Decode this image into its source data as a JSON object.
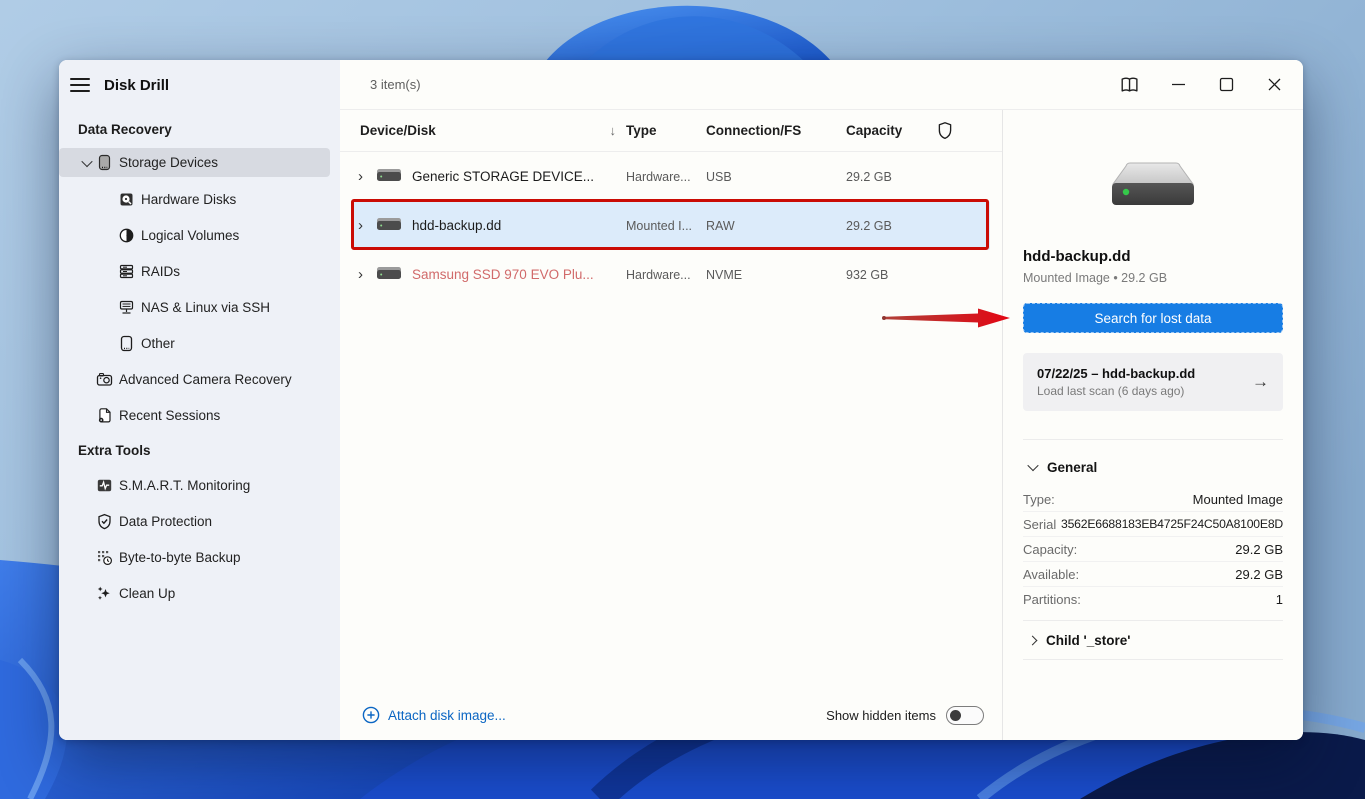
{
  "window": {
    "title": "Disk Drill",
    "item_count": "3 item(s)"
  },
  "icons": {
    "titlebar": [
      "menu-hamburger",
      "knowledge-base-book",
      "minimize",
      "maximize",
      "close"
    ],
    "table_header_shield": "protection-shield",
    "attach_plus": "circled-plus",
    "scan_arrow": "→",
    "sort_arrow": "↓"
  },
  "sidebar": {
    "sections": [
      {
        "header": "Data Recovery",
        "items": [
          {
            "label": "Storage Devices",
            "icon": "storage-devices",
            "selected": true,
            "expanded": true
          },
          {
            "label": "Hardware Disks",
            "icon": "hardware-disk"
          },
          {
            "label": "Logical Volumes",
            "icon": "logical-volume"
          },
          {
            "label": "RAIDs",
            "icon": "raid-stack"
          },
          {
            "label": "NAS & Linux via SSH",
            "icon": "nas-server"
          },
          {
            "label": "Other",
            "icon": "other-device"
          },
          {
            "label": "Advanced Camera Recovery",
            "icon": "camera"
          },
          {
            "label": "Recent Sessions",
            "icon": "session-file-gear"
          }
        ]
      },
      {
        "header": "Extra Tools",
        "items": [
          {
            "label": "S.M.A.R.T. Monitoring",
            "icon": "smart-monitor"
          },
          {
            "label": "Data Protection",
            "icon": "shield-check"
          },
          {
            "label": "Byte-to-byte Backup",
            "icon": "byte-grid-clock"
          },
          {
            "label": "Clean Up",
            "icon": "sparkles"
          }
        ]
      }
    ]
  },
  "table": {
    "columns": [
      "Device/Disk",
      "Type",
      "Connection/FS",
      "Capacity"
    ],
    "rows": [
      {
        "name": "Generic STORAGE DEVICE...",
        "type": "Hardware...",
        "fs": "USB",
        "capacity": "29.2 GB"
      },
      {
        "name": "hdd-backup.dd",
        "type": "Mounted I...",
        "fs": "RAW",
        "capacity": "29.2 GB"
      },
      {
        "name": "Samsung SSD 970 EVO Plu...",
        "type": "Hardware...",
        "fs": "NVME",
        "capacity": "932 GB"
      }
    ]
  },
  "footer": {
    "attach_label": "Attach disk image...",
    "show_hidden_label": "Show hidden items",
    "show_hidden_enabled": false
  },
  "details": {
    "title": "hdd-backup.dd",
    "subtitle": "Mounted Image • 29.2 GB",
    "search_button": "Search for lost data",
    "scan_session": {
      "title": "07/22/25 – hdd-backup.dd",
      "subtitle": "Load last scan (6 days ago)"
    },
    "general": {
      "header": "General",
      "rows": [
        {
          "label": "Type:",
          "value": "Mounted Image"
        },
        {
          "label": "Serial",
          "value": "3562E6688183EB4725F24C50A8100E8D"
        },
        {
          "label": "Capacity:",
          "value": "29.2 GB"
        },
        {
          "label": "Available:",
          "value": "29.2 GB"
        },
        {
          "label": "Partitions:",
          "value": "1"
        }
      ]
    },
    "child_section": "Child '_store'"
  },
  "colors": {
    "accent_button": "#177de4",
    "link_blue": "#0b66c3",
    "selected_row": "#dcebfa",
    "sidebar_selected": "#d7dae1",
    "annotation_red": "#ca0b04",
    "warning_text_red": "#d16a6a",
    "led_green": "#35c94a"
  }
}
